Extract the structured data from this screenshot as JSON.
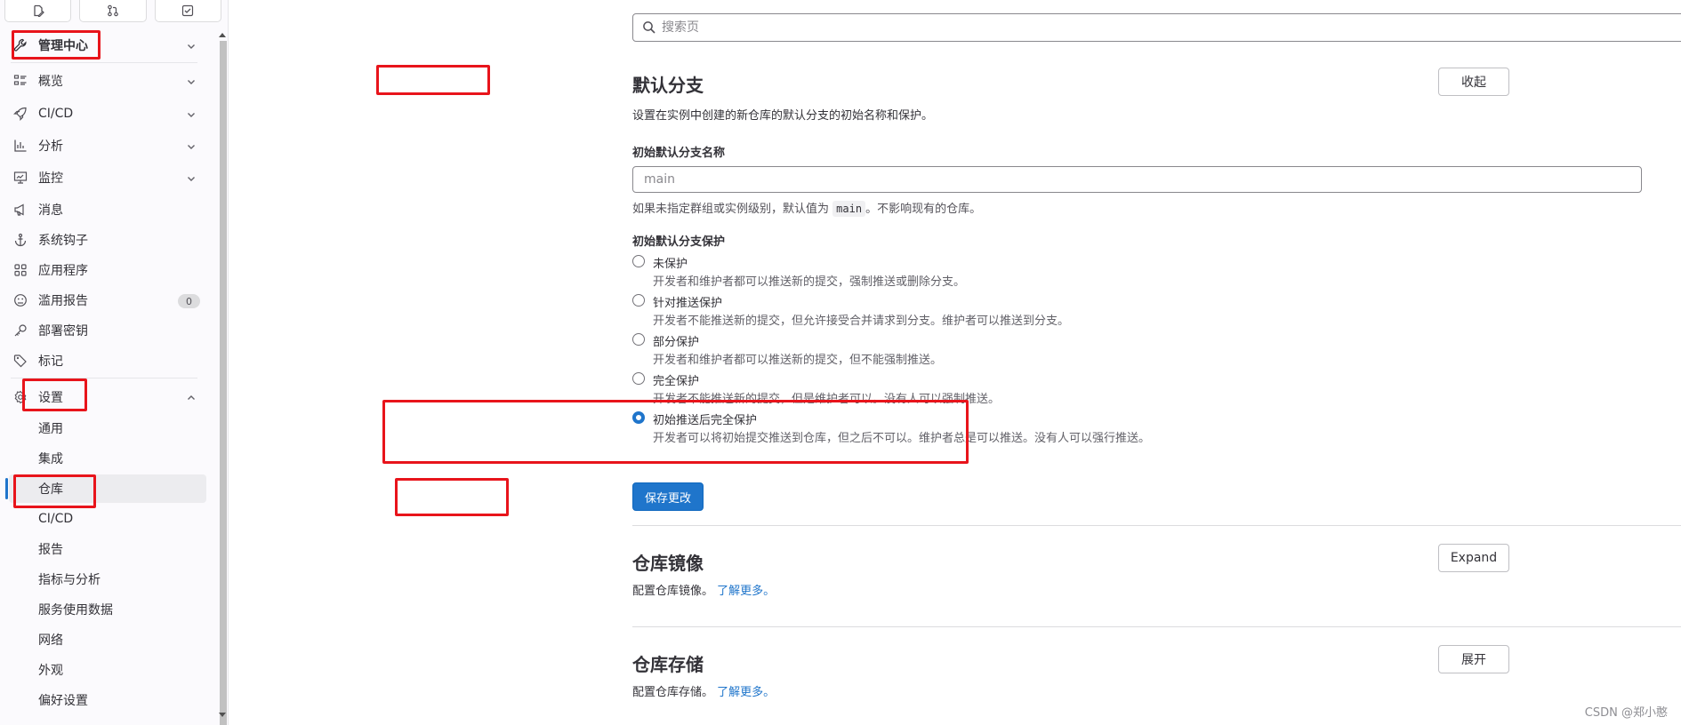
{
  "sidebar": {
    "top_buttons": [
      "edit-icon",
      "merge-request-icon",
      "todo-icon"
    ],
    "header": {
      "label": "管理中心",
      "icon": "wrench-icon"
    },
    "items": [
      {
        "label": "概览",
        "icon": "overview-icon",
        "chevron": true
      },
      {
        "label": "CI/CD",
        "icon": "rocket-icon",
        "chevron": true
      },
      {
        "label": "分析",
        "icon": "chart-icon",
        "chevron": true
      },
      {
        "label": "监控",
        "icon": "monitor-icon",
        "chevron": true
      },
      {
        "label": "消息",
        "icon": "megaphone-icon"
      },
      {
        "label": "系统钩子",
        "icon": "anchor-icon"
      },
      {
        "label": "应用程序",
        "icon": "applications-icon"
      },
      {
        "label": "滥用报告",
        "icon": "abuse-icon",
        "badge": "0"
      },
      {
        "label": "部署密钥",
        "icon": "key-icon"
      },
      {
        "label": "标记",
        "icon": "label-icon"
      }
    ],
    "settings": {
      "label": "设置",
      "icon": "settings-icon",
      "children": [
        "通用",
        "集成",
        "仓库",
        "CI/CD",
        "报告",
        "指标与分析",
        "服务使用数据",
        "网络",
        "外观",
        "偏好设置"
      ],
      "active": "仓库"
    }
  },
  "search": {
    "placeholder": "搜索页"
  },
  "default_branch": {
    "title": "默认分支",
    "collapse_label": "收起",
    "description": "设置在实例中创建的新仓库的默认分支的初始名称和保护。",
    "name_label": "初始默认分支名称",
    "name_placeholder": "main",
    "name_help_before": "如果未指定群组或实例级别，默认值为",
    "name_help_code": "main",
    "name_help_after": "。不影响现有的仓库。",
    "protection_label": "初始默认分支保护",
    "options": [
      {
        "label": "未保护",
        "help": "开发者和维护者都可以推送新的提交，强制推送或删除分支。",
        "checked": false
      },
      {
        "label": "针对推送保护",
        "help": "开发者不能推送新的提交，但允许接受合并请求到分支。维护者可以推送到分支。",
        "checked": false
      },
      {
        "label": "部分保护",
        "help": "开发者和维护者都可以推送新的提交，但不能强制推送。",
        "checked": false
      },
      {
        "label": "完全保护",
        "help": "开发者不能推送新的提交，但是维护者可以。没有人可以强制推送。",
        "checked": false
      },
      {
        "label": "初始推送后完全保护",
        "help": "开发者可以将初始提交推送到仓库，但之后不可以。维护者总是可以推送。没有人可以强行推送。",
        "checked": true
      }
    ],
    "save_label": "保存更改"
  },
  "mirror": {
    "title": "仓库镜像",
    "description": "配置仓库镜像。",
    "link": "了解更多。",
    "button": "Expand"
  },
  "storage": {
    "title": "仓库存储",
    "description": "配置仓库存储。",
    "link": "了解更多。",
    "button": "展开"
  },
  "watermark": "CSDN @郑小憨",
  "colors": {
    "accent": "#1f75cb",
    "annotation": "#e8141b"
  }
}
